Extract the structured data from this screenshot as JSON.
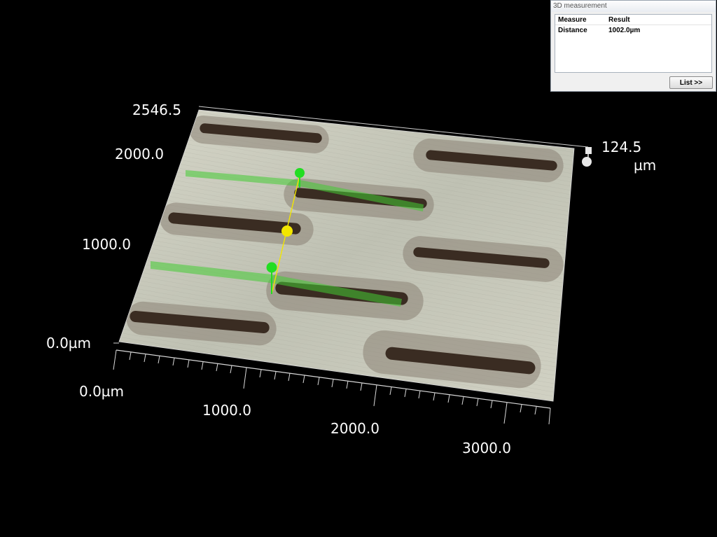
{
  "axes": {
    "y_max": "2546.5",
    "y_ticks": [
      "2000.0",
      "1000.0"
    ],
    "origin": "0.0µm",
    "x_ticks": [
      "0.0µm",
      "1000.0",
      "2000.0",
      "3000.0"
    ],
    "z_max": "124.5",
    "z_unit": "µm"
  },
  "panel": {
    "title": "3D measurement",
    "col_measure": "Measure",
    "col_result": "Result",
    "rows": [
      {
        "measure": "Distance",
        "result": "1002.0µm"
      }
    ],
    "list_button": "List >>"
  },
  "colors": {
    "surface": "#c8c8b8",
    "groove": "#3a2c22",
    "marker_green": "#22dd22",
    "marker_yellow": "#f2e600",
    "background": "#000000"
  }
}
